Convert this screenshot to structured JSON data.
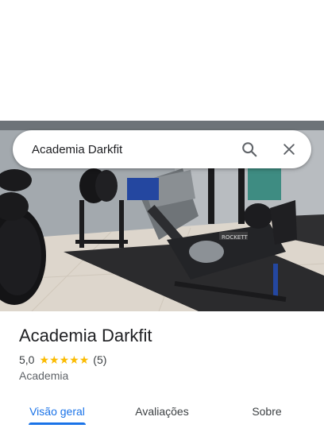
{
  "search": {
    "query": "Academia Darkfit"
  },
  "hero": {
    "machine_brand_text": "ROCKETT"
  },
  "place": {
    "name": "Academia Darkfit",
    "rating": "5,0",
    "stars": [
      "★",
      "★",
      "★",
      "★",
      "★"
    ],
    "review_count": "(5)",
    "category": "Academia"
  },
  "tabs": [
    {
      "label": "Visão geral",
      "active": true
    },
    {
      "label": "Avaliações",
      "active": false
    },
    {
      "label": "Sobre",
      "active": false
    }
  ],
  "colors": {
    "accent": "#1a73e8",
    "star": "#fbbc04",
    "text_primary": "#202124",
    "text_secondary": "#5f6368"
  },
  "icons": {
    "search": "search-icon",
    "close": "close-icon",
    "star": "star-icon"
  }
}
